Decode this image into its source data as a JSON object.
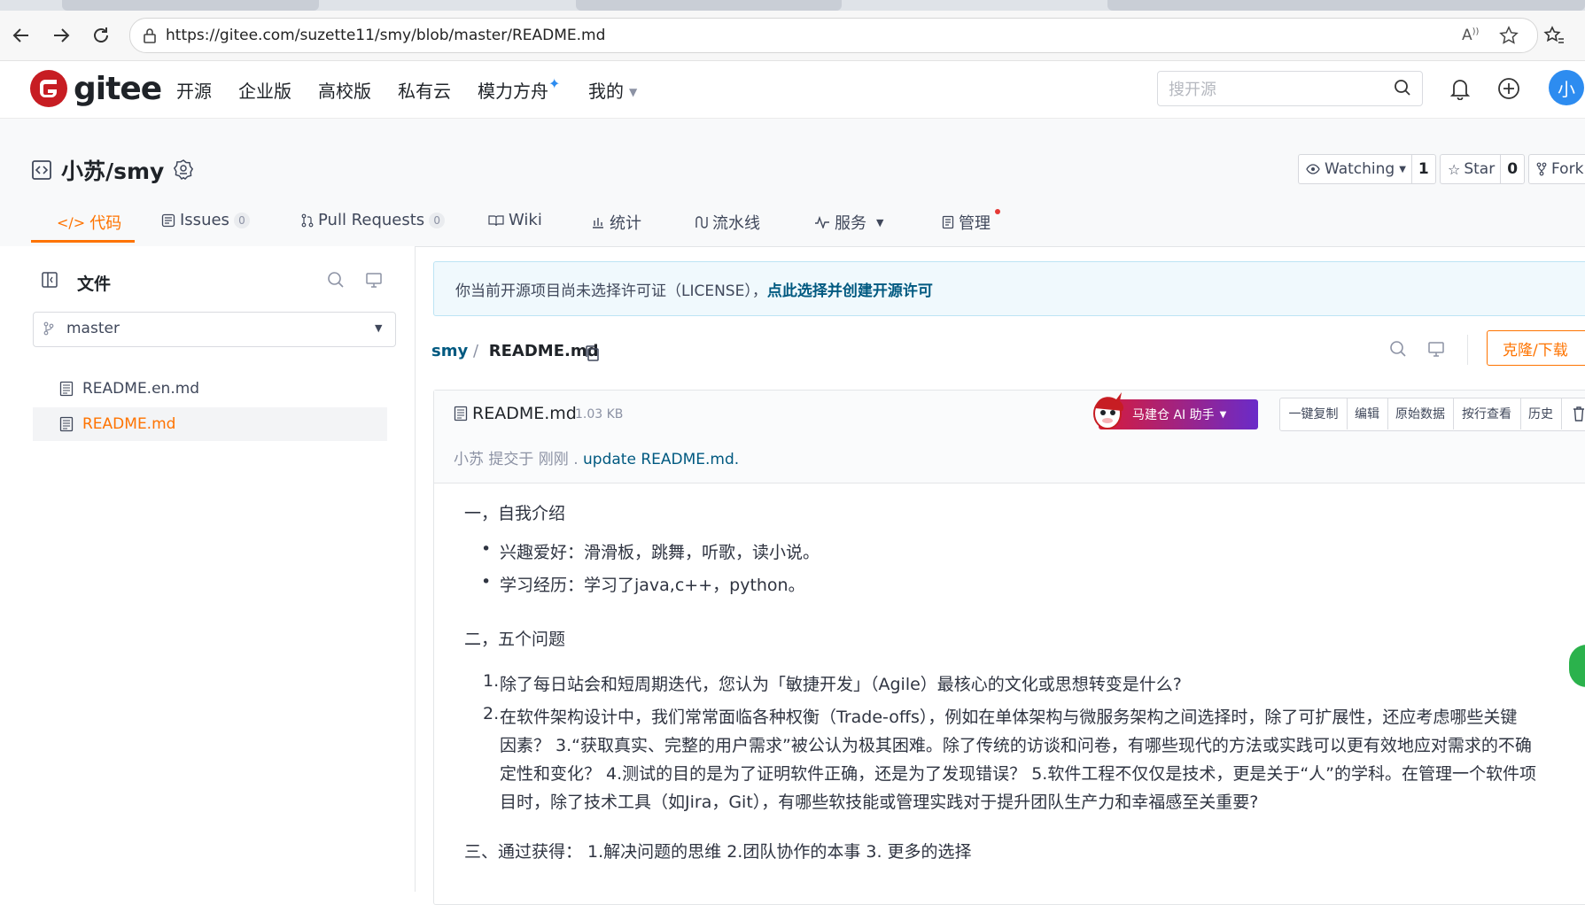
{
  "browser": {
    "url": "https://gitee.com/suzette11/smy/blob/master/README.md"
  },
  "header": {
    "logo_text": "gitee",
    "nav": [
      "开源",
      "企业版",
      "高校版",
      "私有云",
      "模力方舟",
      "我的"
    ],
    "search_placeholder": "搜开源",
    "avatar_text": "小"
  },
  "project": {
    "title": "小苏/smy",
    "watching_label": "Watching",
    "watching_count": "1",
    "star_label": "Star",
    "star_count": "0",
    "fork_label": "Fork",
    "tabs": [
      {
        "label": "代码"
      },
      {
        "label": "Issues",
        "count": "0"
      },
      {
        "label": "Pull Requests",
        "count": "0"
      },
      {
        "label": "Wiki"
      },
      {
        "label": "统计"
      },
      {
        "label": "流水线"
      },
      {
        "label": "服务"
      },
      {
        "label": "管理"
      }
    ]
  },
  "sidebar": {
    "title": "文件",
    "branch": "master",
    "files": [
      "README.en.md",
      "README.md"
    ]
  },
  "main": {
    "license_text": "你当前开源项目尚未选择许可证（LICENSE），",
    "license_link": "点此选择并创建开源许可",
    "breadcrumb_repo": "smy",
    "breadcrumb_sep": "/",
    "breadcrumb_file": "README.md",
    "clone_label": "克隆/下载",
    "file_name": "README.md",
    "file_size": "1.03 KB",
    "ai_label": "马建仓 AI 助手",
    "tools": [
      "一键复制",
      "编辑",
      "原始数据",
      "按行查看",
      "历史"
    ],
    "commit_meta": "小苏 提交于 刚刚 .",
    "commit_msg": "update README.md.",
    "readme": {
      "h1": "一，自我介绍",
      "bullets": [
        "兴趣爱好：滑滑板，跳舞，听歌，读小说。",
        "学习经历：学习了java,c++，python。"
      ],
      "h2": "二，五个问题",
      "q1": "除了每日站会和短周期迭代，您认为「敏捷开发」（Agile）最核心的文化或思想转变是什么?",
      "q2_lines": [
        "在软件架构设计中，我们常常面临各种权衡（Trade-offs），例如在单体架构与微服务架构之间选择时，除了可扩展性，还应考虑哪些关键",
        "因素？ 3.“获取真实、完整的用户需求”被公认为极其困难。除了传统的访谈和问卷，有哪些现代的方法或实践可以更有效地应对需求的不确",
        "定性和变化？ 4.测试的目的是为了证明软件正确，还是为了发现错误？ 5.软件工程不仅仅是技术，更是关于“人”的学科。在管理一个软件项",
        "目时，除了技术工具（如Jira，Git），有哪些软技能或管理实践对于提升团队生产力和幸福感至关重要?"
      ],
      "h3": "三、通过获得： 1.解决问题的思维 2.团队协作的本事 3. 更多的选择"
    }
  },
  "colors": {
    "brand": "#c71d23",
    "accent": "#fe7300",
    "link": "#005980",
    "avatar_bg": "#2d8cf0"
  }
}
